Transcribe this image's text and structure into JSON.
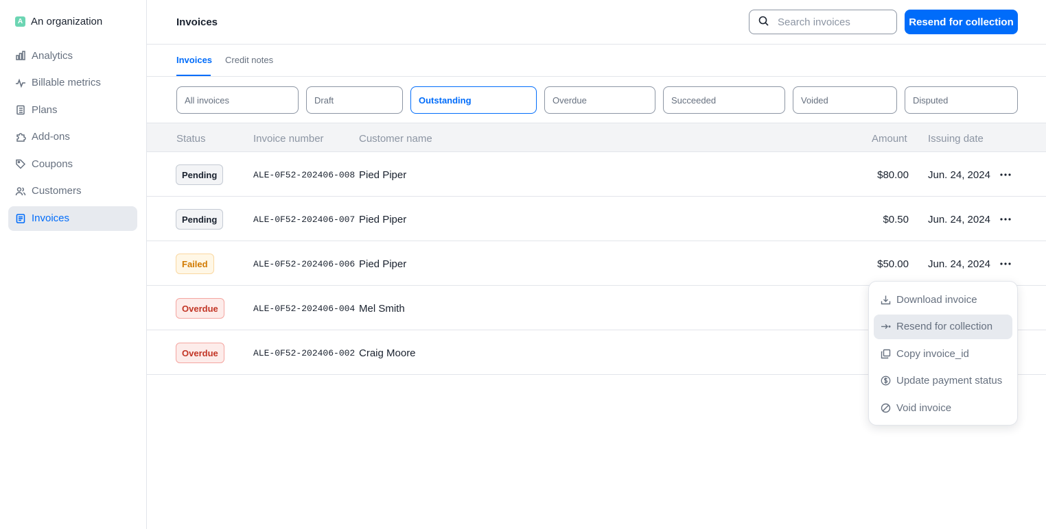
{
  "org": {
    "badge": "A",
    "name": "An organization"
  },
  "sidebar": {
    "items": [
      {
        "label": "Analytics",
        "icon": "bar-chart-icon"
      },
      {
        "label": "Billable metrics",
        "icon": "pulse-icon"
      },
      {
        "label": "Plans",
        "icon": "clipboard-icon"
      },
      {
        "label": "Add-ons",
        "icon": "puzzle-icon"
      },
      {
        "label": "Coupons",
        "icon": "tag-icon"
      },
      {
        "label": "Customers",
        "icon": "users-icon"
      },
      {
        "label": "Invoices",
        "icon": "document-icon",
        "active": true
      }
    ]
  },
  "header": {
    "title": "Invoices",
    "search_placeholder": "Search invoices",
    "primary_button": "Resend for collection"
  },
  "tabs": [
    {
      "label": "Invoices",
      "active": true
    },
    {
      "label": "Credit notes"
    }
  ],
  "filters": [
    {
      "label": "All invoices"
    },
    {
      "label": "Draft"
    },
    {
      "label": "Outstanding",
      "active": true
    },
    {
      "label": "Overdue"
    },
    {
      "label": "Succeeded"
    },
    {
      "label": "Voided"
    },
    {
      "label": "Disputed"
    }
  ],
  "table": {
    "columns": {
      "status": "Status",
      "number": "Invoice number",
      "customer": "Customer name",
      "amount": "Amount",
      "date": "Issuing date"
    },
    "rows": [
      {
        "status": "Pending",
        "status_kind": "pending",
        "number": "ALE-0F52-202406-008",
        "customer": "Pied Piper",
        "amount": "$80.00",
        "date": "Jun. 24, 2024"
      },
      {
        "status": "Pending",
        "status_kind": "pending",
        "number": "ALE-0F52-202406-007",
        "customer": "Pied Piper",
        "amount": "$0.50",
        "date": "Jun. 24, 2024"
      },
      {
        "status": "Failed",
        "status_kind": "failed",
        "number": "ALE-0F52-202406-006",
        "customer": "Pied Piper",
        "amount": "$50.00",
        "date": "Jun. 24, 2024"
      },
      {
        "status": "Overdue",
        "status_kind": "overdue",
        "number": "ALE-0F52-202406-004",
        "customer": "Mel Smith",
        "amount": "",
        "date": ""
      },
      {
        "status": "Overdue",
        "status_kind": "overdue",
        "number": "ALE-0F52-202406-002",
        "customer": "Craig Moore",
        "amount": "",
        "date": ""
      }
    ]
  },
  "menu": {
    "items": [
      {
        "label": "Download invoice",
        "icon": "download-icon"
      },
      {
        "label": "Resend for collection",
        "icon": "arrow-right-icon",
        "hover": true
      },
      {
        "label": "Copy invoice_id",
        "icon": "copy-icon"
      },
      {
        "label": "Update payment status",
        "icon": "dollar-circle-icon"
      },
      {
        "label": "Void invoice",
        "icon": "ban-icon"
      }
    ]
  },
  "colors": {
    "accent": "#006cfa",
    "text": "#19212e",
    "muted": "#66707f",
    "border": "#e2e5ea"
  }
}
